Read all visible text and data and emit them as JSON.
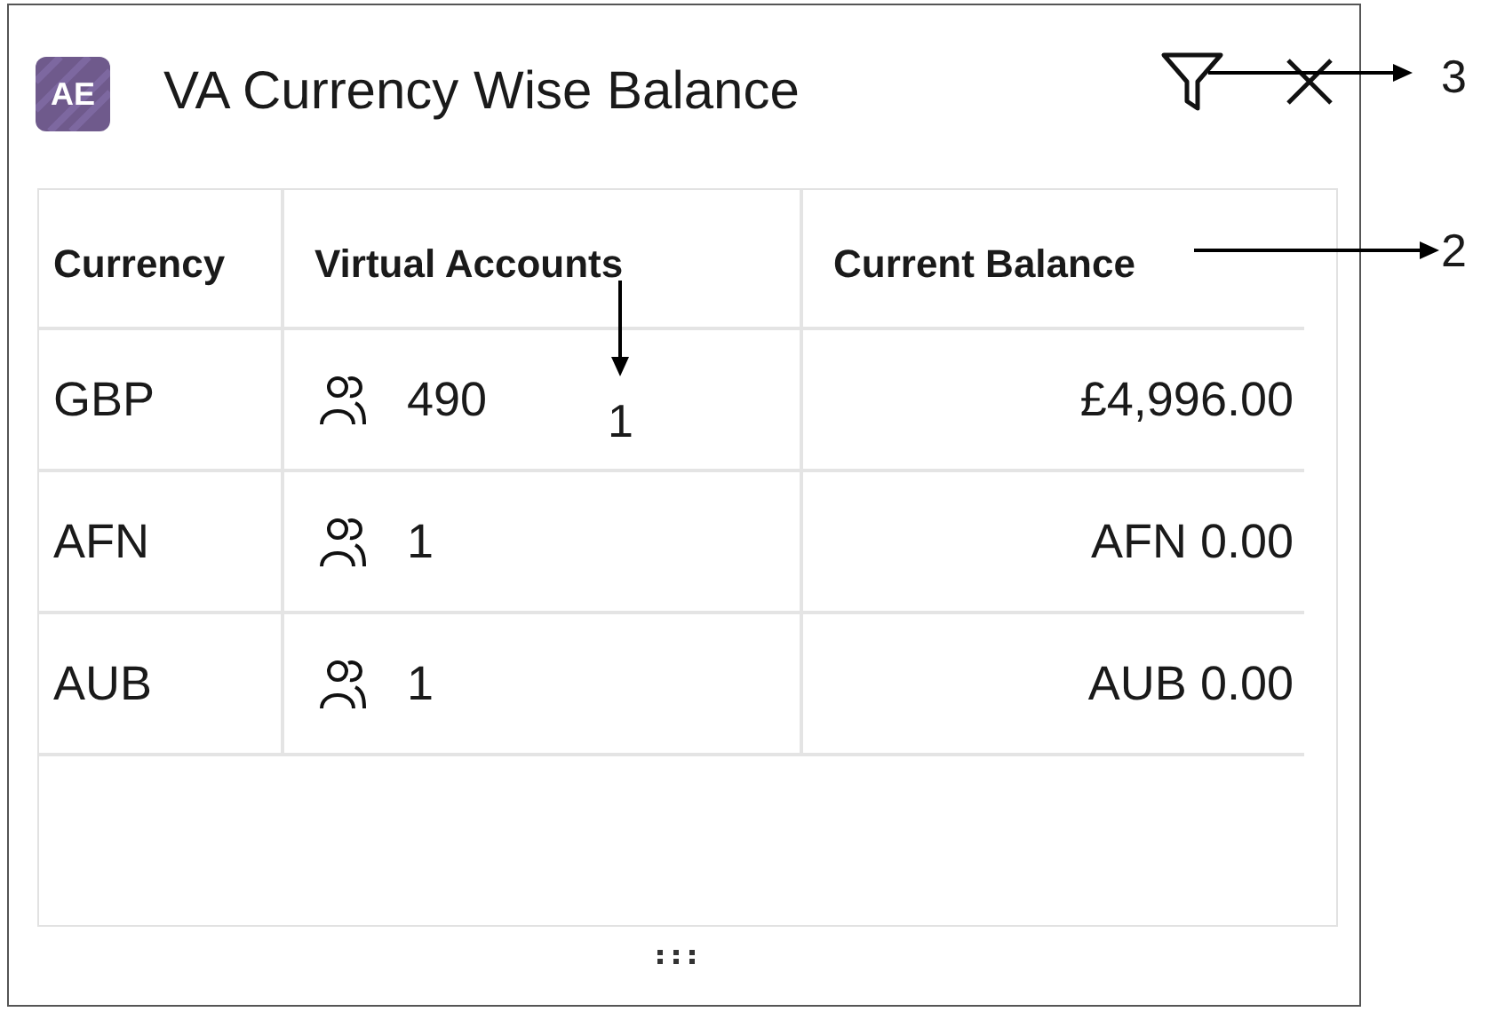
{
  "card": {
    "avatar": "AE",
    "title": "VA Currency Wise Balance"
  },
  "table": {
    "columns": [
      "Currency",
      "Virtual Accounts",
      "Current Balance"
    ],
    "rows": [
      {
        "currency": "GBP",
        "virtual_accounts": "490",
        "current_balance": "£4,996.00"
      },
      {
        "currency": "AFN",
        "virtual_accounts": "1",
        "current_balance": "AFN 0.00"
      },
      {
        "currency": "AUB",
        "virtual_accounts": "1",
        "current_balance": "AUB 0.00"
      }
    ]
  },
  "callouts": [
    {
      "label": "1"
    },
    {
      "label": "2"
    },
    {
      "label": "3"
    }
  ]
}
